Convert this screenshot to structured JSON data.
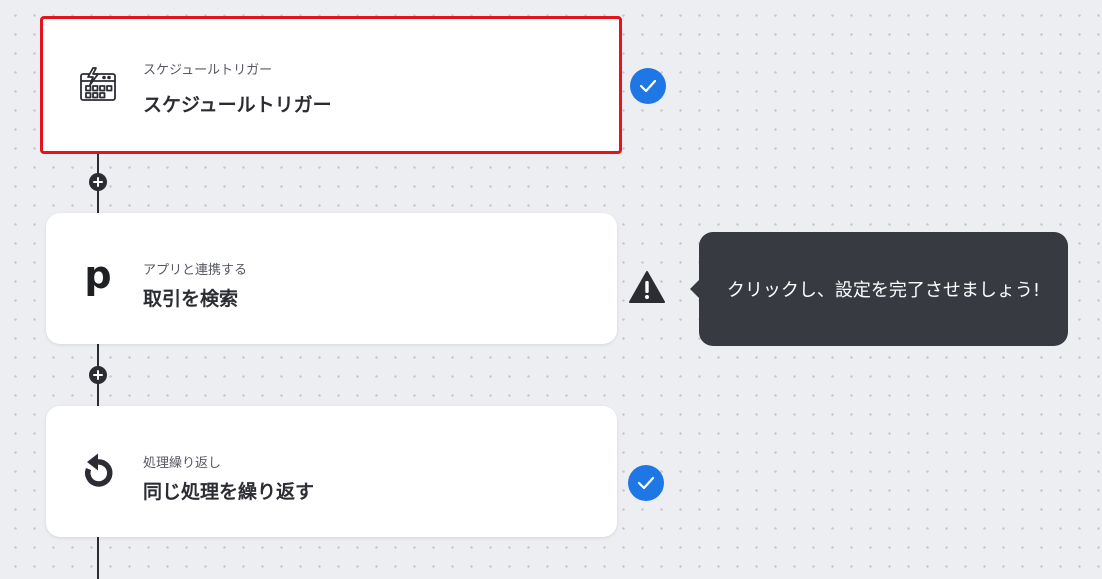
{
  "colors": {
    "accent": "#1f77e5",
    "selection_border": "#e3141d",
    "dark": "#2b2d33",
    "tooltip_bg": "#373a41"
  },
  "flow": {
    "steps": [
      {
        "subtitle": "スケジュールトリガー",
        "title": "スケジュールトリガー",
        "icon": "schedule-trigger-icon",
        "status": "complete",
        "selected": true
      },
      {
        "subtitle": "アプリと連携する",
        "title": "取引を検索",
        "icon": "p",
        "status": "warning",
        "selected": false
      },
      {
        "subtitle": "処理繰り返し",
        "title": "同じ処理を繰り返す",
        "icon": "repeat-icon",
        "status": "complete",
        "selected": false
      }
    ],
    "add_step_icon": "plus-icon"
  },
  "tooltip": {
    "text": "クリックし、設定を完了させましょう!"
  }
}
